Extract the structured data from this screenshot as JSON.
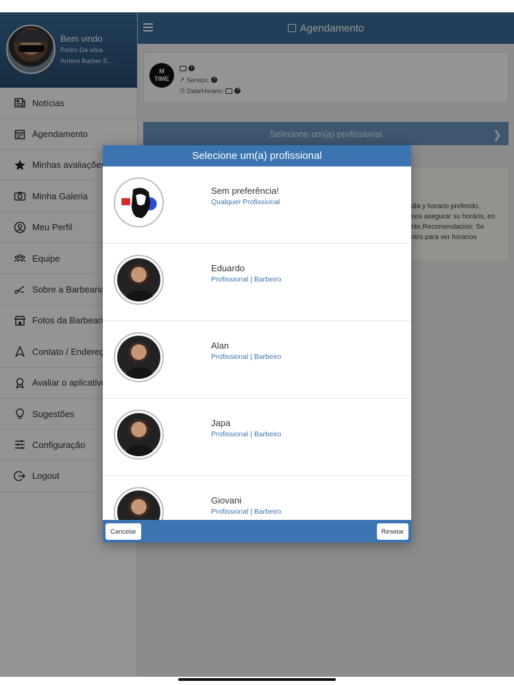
{
  "sidebar": {
    "welcome": "Bem vindo",
    "user_name": "Pedro Da silva",
    "shop_name": "Arriero Barber Sh...",
    "items": [
      {
        "label": "Notícias",
        "icon": "newspaper-icon"
      },
      {
        "label": "Agendamento",
        "icon": "calendar-icon"
      },
      {
        "label": "Minhas avaliações",
        "icon": "star-icon"
      },
      {
        "label": "Minha Galeria",
        "icon": "camera-icon"
      },
      {
        "label": "Meu Perfil",
        "icon": "user-circle-icon"
      },
      {
        "label": "Equipe",
        "icon": "team-icon"
      },
      {
        "label": "Sobre a Barbearia",
        "icon": "scissors-icon"
      },
      {
        "label": "Fotos da Barbearia",
        "icon": "store-icon"
      },
      {
        "label": "Contato / Endereço",
        "icon": "navigation-icon"
      },
      {
        "label": "Avaliar o aplicativo",
        "icon": "award-icon"
      },
      {
        "label": "Sugestões",
        "icon": "lightbulb-icon"
      },
      {
        "label": "Configuração",
        "icon": "sliders-icon"
      },
      {
        "label": "Logout",
        "icon": "logout-icon"
      }
    ]
  },
  "header": {
    "title": "Agendamento"
  },
  "booking": {
    "logo_top": "M",
    "logo_bottom": "TIME",
    "service_label": "Serviço:",
    "datetime_label": "Data/Horário:"
  },
  "select_bar": {
    "label": "Selecione um(a) profissional"
  },
  "notice": {
    "line1": "dia y horario preferido.",
    "line2": "nos asegurar su horário, en",
    "line3": "nte.Recomendación: Se",
    "line4": "otro para ver horarios"
  },
  "modal": {
    "title": "Selecione um(a) profissional",
    "professionals": [
      {
        "name": "Sem preferência!",
        "role": "Qualquer Profissional"
      },
      {
        "name": "Eduardo",
        "role": "Profissional | Barbeiro"
      },
      {
        "name": "Alan",
        "role": "Profissional | Barbeiro"
      },
      {
        "name": "Japa",
        "role": "Profissional | Barbeiro"
      },
      {
        "name": "Giovani",
        "role": "Profissional | Barbeiro"
      }
    ],
    "cancel_label": "Cancelar",
    "reset_label": "Resetar"
  },
  "colors": {
    "primary": "#3b74b0",
    "topbar": "#3b6d99",
    "link": "#3b74b0"
  }
}
